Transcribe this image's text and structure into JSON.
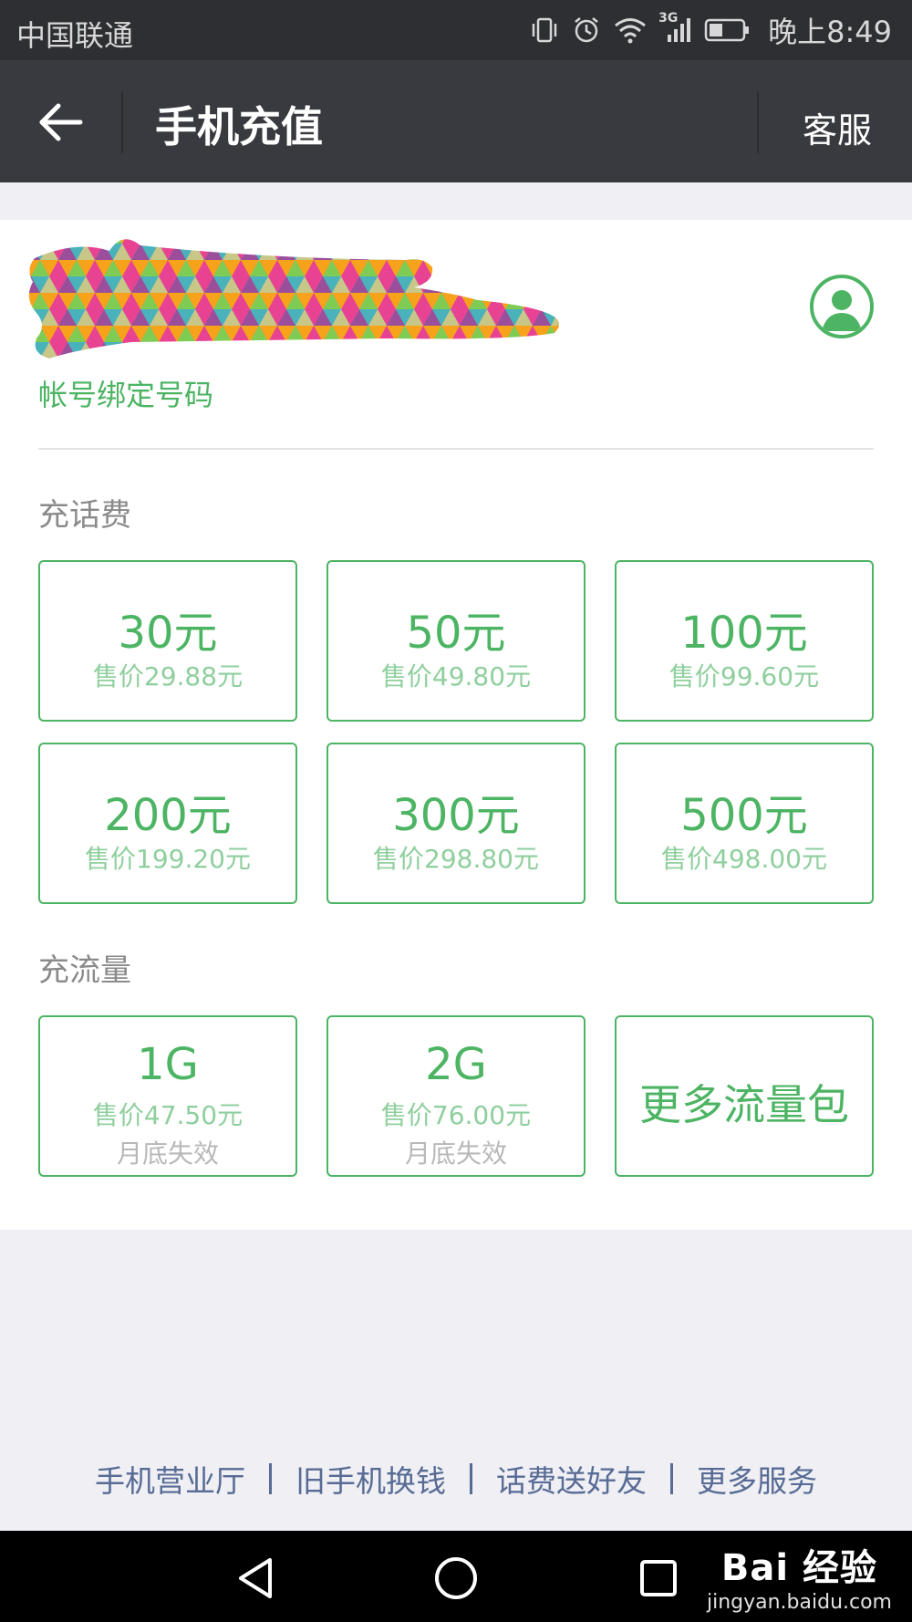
{
  "status_bar": {
    "carrier": "中国联通",
    "network": "3G",
    "time": "晚上8:49"
  },
  "nav": {
    "title": "手机充值",
    "service": "客服"
  },
  "account": {
    "bound_label": "帐号绑定号码"
  },
  "phone_credit": {
    "title": "充话费",
    "options": [
      {
        "amount": "30元",
        "price": "售价29.88元"
      },
      {
        "amount": "50元",
        "price": "售价49.80元"
      },
      {
        "amount": "100元",
        "price": "售价99.60元"
      },
      {
        "amount": "200元",
        "price": "售价199.20元"
      },
      {
        "amount": "300元",
        "price": "售价298.80元"
      },
      {
        "amount": "500元",
        "price": "售价498.00元"
      }
    ]
  },
  "data_plan": {
    "title": "充流量",
    "options": [
      {
        "amount": "1G",
        "price": "售价47.50元",
        "expiry": "月底失效"
      },
      {
        "amount": "2G",
        "price": "售价76.00元",
        "expiry": "月底失效"
      }
    ],
    "more": "更多流量包"
  },
  "footer": {
    "links": [
      "手机营业厅",
      "旧手机换钱",
      "话费送好友",
      "更多服务"
    ]
  },
  "watermark": {
    "main": "Bai 经验",
    "sub": "jingyan.baidu.com"
  },
  "colors": {
    "accent": "#4cb463",
    "nav_bg": "#393a3f",
    "status_bg": "#2e2f33",
    "link": "#576b95",
    "page_bg": "#efeff4"
  }
}
